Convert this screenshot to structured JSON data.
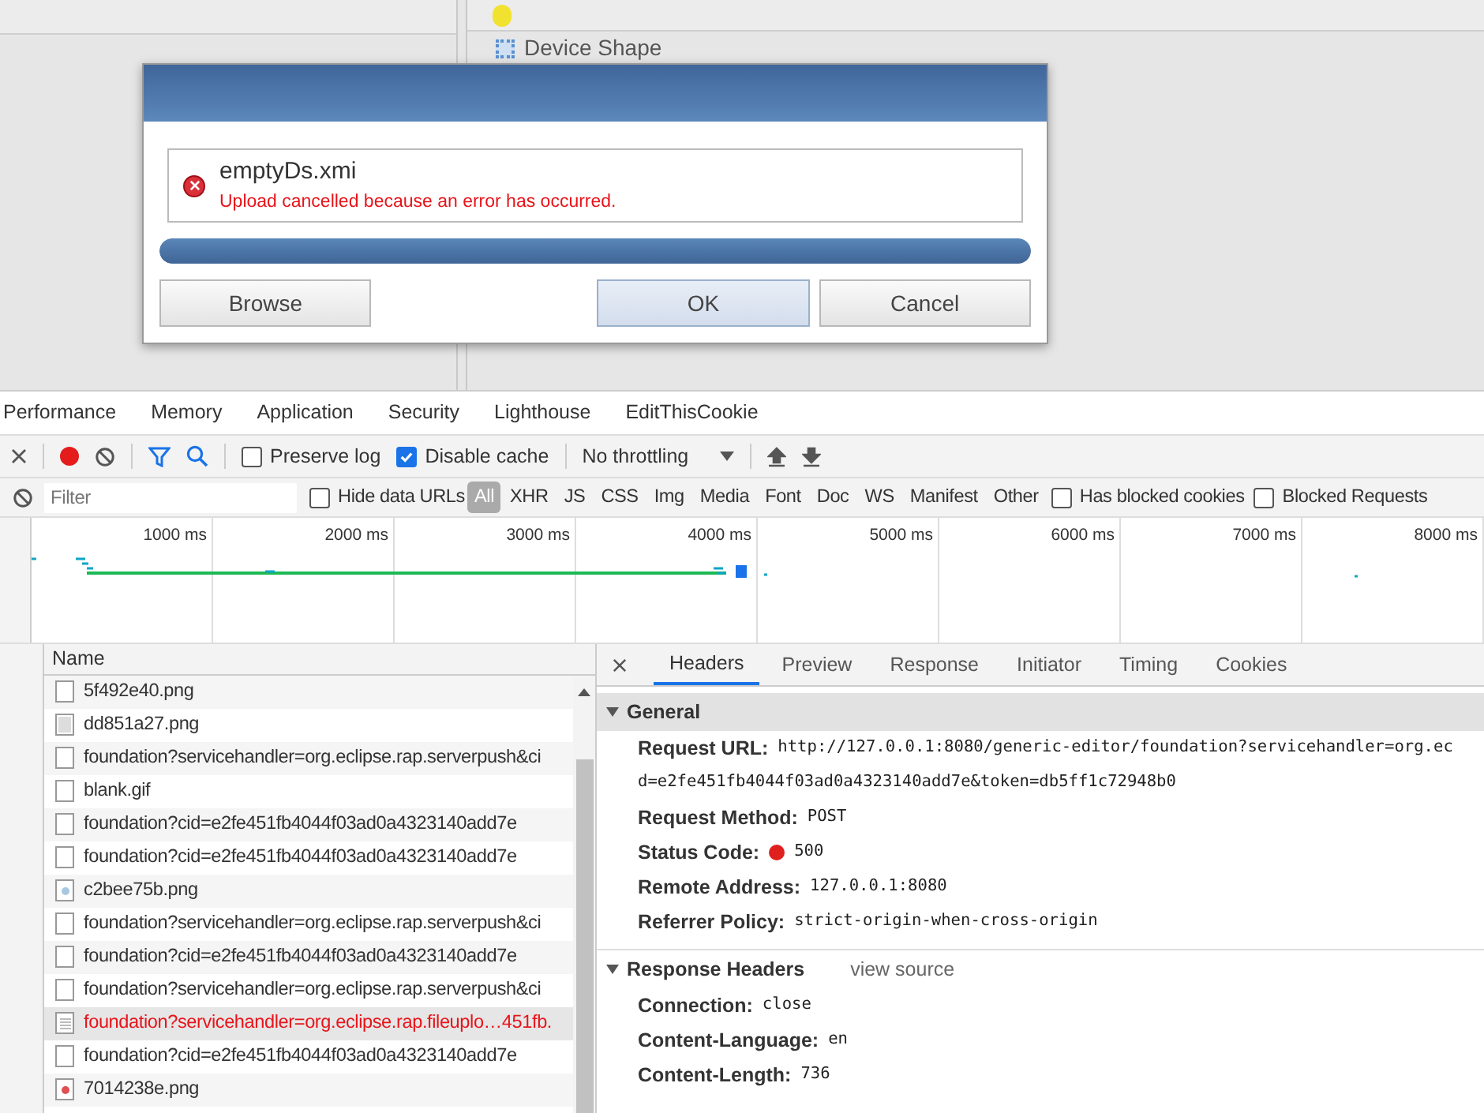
{
  "background": {
    "panel_title": "Device Shape"
  },
  "dialog": {
    "file_name": "emptyDs.xmi",
    "message": "Upload cancelled because an error has occurred.",
    "failed": true,
    "progress": {
      "level": 1
    },
    "buttons": [
      {
        "label": "Browse",
        "focused": false
      },
      {
        "label": "OK",
        "focused": true
      },
      {
        "label": "Cancel",
        "focused": false
      }
    ]
  },
  "devtools": {
    "panel_tabs": [
      {
        "label": "Performance",
        "selected": false
      },
      {
        "label": "Memory",
        "selected": false
      },
      {
        "label": "Application",
        "selected": false
      },
      {
        "label": "Security",
        "selected": false
      },
      {
        "label": "Lighthouse",
        "selected": false
      },
      {
        "label": "EditThisCookie",
        "selected": false
      }
    ],
    "toolbar": {
      "recording": true,
      "filter_active": true,
      "preserve_log": {
        "label": "Preserve log",
        "checked": false
      },
      "disable_cache": {
        "label": "Disable cache",
        "checked": true
      },
      "throttling": "No throttling"
    },
    "filter_bar": {
      "placeholder": "Filter",
      "hide_data_urls": {
        "label": "Hide data URLs",
        "checked": false
      },
      "types": [
        {
          "label": "All",
          "selected": true
        },
        {
          "label": "XHR",
          "selected": false
        },
        {
          "label": "JS",
          "selected": false
        },
        {
          "label": "CSS",
          "selected": false
        },
        {
          "label": "Img",
          "selected": false
        },
        {
          "label": "Media",
          "selected": false
        },
        {
          "label": "Font",
          "selected": false
        },
        {
          "label": "Doc",
          "selected": false
        },
        {
          "label": "WS",
          "selected": false
        },
        {
          "label": "Manifest",
          "selected": false
        },
        {
          "label": "Other",
          "selected": false
        }
      ],
      "has_blocked_cookies": {
        "label": "Has blocked cookies",
        "checked": false
      },
      "blocked_requests": {
        "label": "Blocked Requests",
        "checked": false
      }
    },
    "overview": {
      "ticks": [
        "1000 ms",
        "2000 ms",
        "3000 ms",
        "4000 ms",
        "5000 ms",
        "6000 ms",
        "7000 ms",
        "8000 ms"
      ]
    },
    "requests": {
      "column": "Name",
      "rows": [
        {
          "name": "5f492e40.png",
          "kind": "doc",
          "error": false,
          "selected": false
        },
        {
          "name": "dd851a27.png",
          "kind": "fill",
          "color": "#dddddd",
          "error": false,
          "selected": false
        },
        {
          "name": "foundation?servicehandler=org.eclipse.rap.serverpush&ci",
          "kind": "doc",
          "error": false,
          "selected": false
        },
        {
          "name": "blank.gif",
          "kind": "doc",
          "error": false,
          "selected": false
        },
        {
          "name": "foundation?cid=e2fe451fb4044f03ad0a4323140add7e",
          "kind": "doc",
          "error": false,
          "selected": false
        },
        {
          "name": "foundation?cid=e2fe451fb4044f03ad0a4323140add7e",
          "kind": "doc",
          "error": false,
          "selected": false
        },
        {
          "name": "c2bee75b.png",
          "kind": "dot",
          "color": "#a8c8e0",
          "error": false,
          "selected": false
        },
        {
          "name": "foundation?servicehandler=org.eclipse.rap.serverpush&ci",
          "kind": "doc",
          "error": false,
          "selected": false
        },
        {
          "name": "foundation?cid=e2fe451fb4044f03ad0a4323140add7e",
          "kind": "doc",
          "error": false,
          "selected": false
        },
        {
          "name": "foundation?servicehandler=org.eclipse.rap.serverpush&ci",
          "kind": "doc",
          "error": false,
          "selected": false
        },
        {
          "name": "foundation?servicehandler=org.eclipse.rap.fileuplo…451fb.",
          "kind": "text",
          "error": true,
          "selected": true
        },
        {
          "name": "foundation?cid=e2fe451fb4044f03ad0a4323140add7e",
          "kind": "doc",
          "error": false,
          "selected": false
        },
        {
          "name": "7014238e.png",
          "kind": "dot",
          "color": "#e05050",
          "error": false,
          "selected": false
        }
      ]
    },
    "details": {
      "tabs": [
        {
          "label": "Headers",
          "selected": true
        },
        {
          "label": "Preview",
          "selected": false
        },
        {
          "label": "Response",
          "selected": false
        },
        {
          "label": "Initiator",
          "selected": false
        },
        {
          "label": "Timing",
          "selected": false
        },
        {
          "label": "Cookies",
          "selected": false
        }
      ],
      "sections": [
        {
          "title": "General",
          "expanded": true,
          "rows": [
            {
              "label": "Request URL:",
              "value_lines": [
                "http://127.0.0.1:8080/generic-editor/foundation?servicehandler=org.ec",
                "d=e2fe451fb4044f03ad0a4323140add7e&token=db5ff1c72948b0"
              ]
            },
            {
              "label": "Request Method:",
              "value_lines": [
                "POST"
              ]
            },
            {
              "label": "Status Code:",
              "color": "#e0201f",
              "value_lines": [
                "500"
              ]
            },
            {
              "label": "Remote Address:",
              "value_lines": [
                "127.0.0.1:8080"
              ]
            },
            {
              "label": "Referrer Policy:",
              "value_lines": [
                "strict-origin-when-cross-origin"
              ]
            }
          ]
        },
        {
          "title": "Response Headers",
          "link": "view source",
          "expanded": true,
          "rows": [
            {
              "label": "Connection:",
              "value_lines": [
                "close"
              ]
            },
            {
              "label": "Content-Language:",
              "value_lines": [
                "en"
              ]
            },
            {
              "label": "Content-Length:",
              "value_lines": [
                "736"
              ]
            }
          ]
        }
      ]
    }
  }
}
